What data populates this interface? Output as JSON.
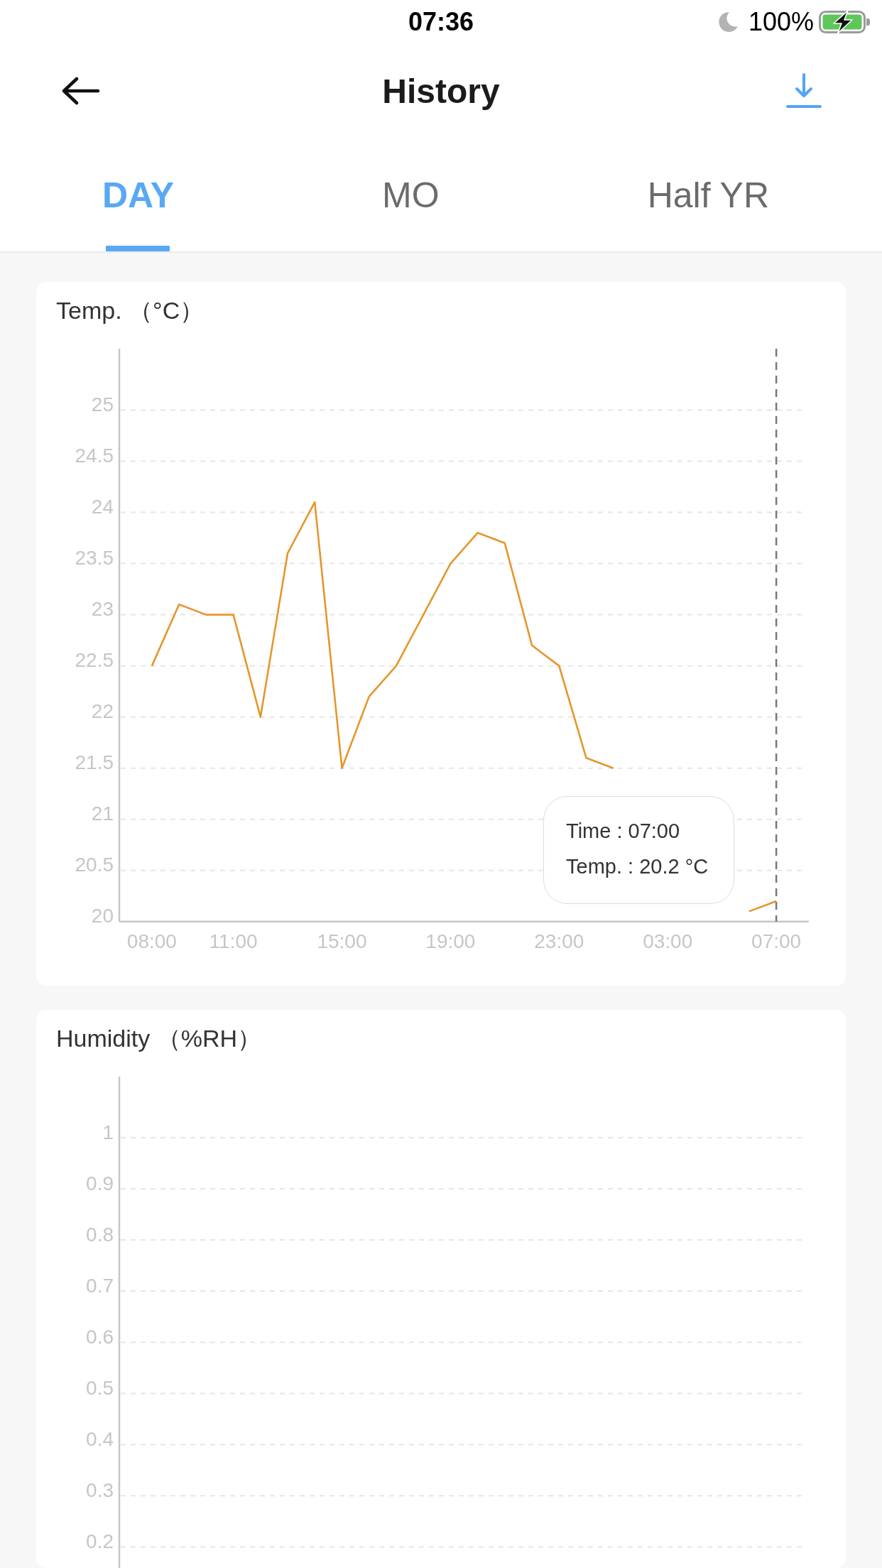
{
  "status_bar": {
    "time": "07:36",
    "battery": "100%"
  },
  "header": {
    "title": "History"
  },
  "tabs": [
    {
      "label": "DAY",
      "selected": true
    },
    {
      "label": "MO",
      "selected": false
    },
    {
      "label": "Half YR",
      "selected": false
    }
  ],
  "charts": [
    {
      "title": "Temp. （°C）",
      "tooltip": {
        "lines": [
          "Time : 07:00",
          "Temp. : 20.2 °C"
        ]
      },
      "chart_data": {
        "type": "line",
        "categories": [
          "08:00",
          null,
          null,
          "11:00",
          null,
          null,
          null,
          "15:00",
          null,
          null,
          null,
          "19:00",
          null,
          null,
          null,
          "23:00",
          null,
          null,
          null,
          "03:00",
          null,
          null,
          null,
          "07:00"
        ],
        "ylim": [
          20,
          25.6
        ],
        "yticks": [
          20,
          20.5,
          21,
          21.5,
          22,
          22.5,
          23,
          23.5,
          24,
          24.5,
          25
        ],
        "grid": true,
        "series": [
          {
            "color": "#e5962c",
            "values": [
              22.5,
              23.1,
              23,
              23,
              22,
              23.6,
              24.1,
              21.5,
              22.2,
              22.5,
              23,
              23.5,
              23.8,
              23.7,
              22.7,
              22.5,
              21.6,
              21.5,
              null,
              null,
              null,
              null,
              20.1,
              20.2
            ]
          }
        ],
        "ref_lines": [
          {
            "axis": "x",
            "value": "07:00"
          }
        ]
      }
    },
    {
      "title": "Humidity （%RH）",
      "y_labels": [
        "1",
        "0.9",
        "0.8",
        "0.7",
        "0.6",
        "0.5",
        "0.4",
        "0.3",
        "0.2"
      ]
    }
  ]
}
